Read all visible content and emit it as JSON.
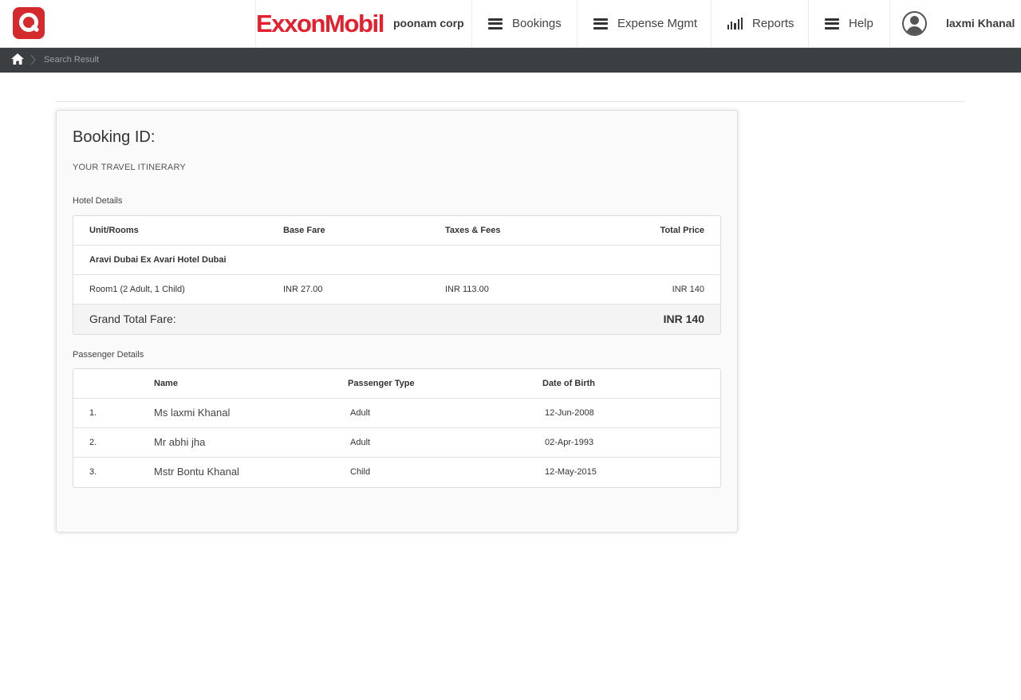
{
  "header": {
    "brand": "ExxonMobil",
    "company": "poonam corp",
    "nav": [
      {
        "label": "Bookings",
        "icon": "menu-icon"
      },
      {
        "label": "Expense Mgmt",
        "icon": "menu-icon"
      },
      {
        "label": "Reports",
        "icon": "bar-chart-icon"
      },
      {
        "label": "Help",
        "icon": "menu-icon"
      }
    ],
    "user": {
      "name": "laxmi Khanal",
      "icon": "user-avatar-icon"
    }
  },
  "breadcrumb": {
    "home_icon": "home-icon",
    "current": "Search Result"
  },
  "booking": {
    "title": "Booking ID:",
    "itinerary_label": "YOUR TRAVEL ITINERARY",
    "hotel_section_label": "Hotel Details",
    "hotel_table": {
      "headers": {
        "unit": "Unit/Rooms",
        "base": "Base Fare",
        "taxes": "Taxes & Fees",
        "total": "Total Price"
      },
      "hotel_name": "Aravi Dubai Ex Avari Hotel Dubai",
      "rooms": [
        {
          "unit": "Room1 (2 Adult, 1 Child)",
          "base": "INR 27.00",
          "taxes": "INR 113.00",
          "total": "INR 140"
        }
      ],
      "grand_total_label": "Grand Total Fare:",
      "grand_total_value": "INR 140"
    },
    "passenger_section_label": "Passenger Details",
    "passenger_table": {
      "headers": {
        "name": "Name",
        "type": "Passenger Type",
        "dob": "Date of Birth"
      },
      "rows": [
        {
          "index": "1.",
          "name": "Ms laxmi Khanal",
          "type": "Adult",
          "dob": "12-Jun-2008"
        },
        {
          "index": "2.",
          "name": "Mr abhi jha",
          "type": "Adult",
          "dob": "02-Apr-1993"
        },
        {
          "index": "3.",
          "name": "Mstr Bontu Khanal",
          "type": "Child",
          "dob": "12-May-2015"
        }
      ]
    }
  },
  "colors": {
    "brand_red": "#e4202e",
    "app_logo": "#d42a2e",
    "breadcrumb_bar": "#3b3f42"
  }
}
